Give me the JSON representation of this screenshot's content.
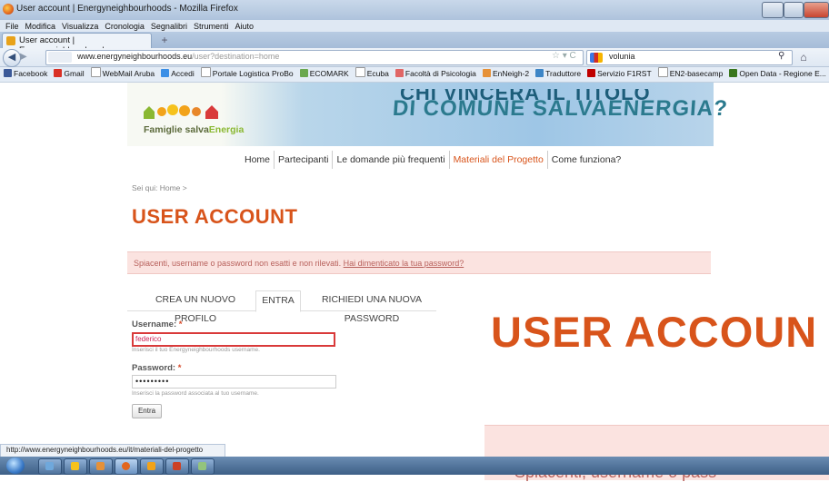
{
  "window": {
    "title": "User account | Energyneighbourhoods - Mozilla Firefox"
  },
  "menu": [
    "File",
    "Modifica",
    "Visualizza",
    "Cronologia",
    "Segnalibri",
    "Strumenti",
    "Aiuto"
  ],
  "tab": {
    "label": "User account | Energyneighbourhoods",
    "new_tab": "+"
  },
  "nav": {
    "url_domain": "www.energyneighbourhoods.eu",
    "url_path": "/user?destination=home",
    "search_value": "volunia"
  },
  "bookmarks": [
    {
      "label": "Facebook",
      "color": "#3b5998"
    },
    {
      "label": "Gmail",
      "color": "#d93025"
    },
    {
      "label": "WebMail Aruba",
      "color": "#ffffff"
    },
    {
      "label": "Accedi",
      "color": "#3a8ee6"
    },
    {
      "label": "Portale Logistica ProBo",
      "color": "#ffffff"
    },
    {
      "label": "ECOMARK",
      "color": "#6aa84f"
    },
    {
      "label": "Ecuba",
      "color": "#ffffff"
    },
    {
      "label": "Facoltà di Psicologia",
      "color": "#e06666"
    },
    {
      "label": "EnNeigh-2",
      "color": "#e69138"
    },
    {
      "label": "Traduttore",
      "color": "#3d85c6"
    },
    {
      "label": "Servizio F1RST",
      "color": "#c00000"
    },
    {
      "label": "EN2-basecamp",
      "color": "#ffffff"
    },
    {
      "label": "Open Data - Regione E...",
      "color": "#38761d"
    }
  ],
  "site": {
    "logo_text_a": "Famiglie salva",
    "logo_text_b": "Energia",
    "slogan_line1": "CHI VINCERÀ IL TITOLO",
    "slogan_line2": "DI COMUNE SALVAENERGIA?",
    "nav": [
      "Home",
      "Partecipanti",
      "Le domande più frequenti",
      "Materiali del Progetto",
      "Come funziona?"
    ],
    "breadcrumb": "Sei qui: Home >",
    "page_title": "USER ACCOUNT",
    "error_text": "Spiacenti, username o password non esatti e non rilevati.",
    "error_link": "Hai dimenticato la tua password?",
    "tabs": [
      "CREA UN NUOVO PROFILO",
      "ENTRA",
      "RICHIEDI UNA NUOVA PASSWORD"
    ],
    "username_label": "Username:",
    "username_value": "federico",
    "username_help": "Inserisci il tuo Energyneighbourhoods username.",
    "password_label": "Password:",
    "password_value": "•••••••••",
    "password_help": "Inserisci la password associata al tuo username.",
    "required_mark": "*",
    "submit_label": "Entra"
  },
  "zoom": {
    "title": "USER ACCOUN",
    "text": "Spiacenti, username o pass"
  },
  "status_text": "http://www.energyneighbourhoods.eu/it/materiali-del-progetto",
  "colors": {
    "accent": "#d8541b",
    "error_bg": "#fbe3e0",
    "error_text": "#b8615c"
  }
}
